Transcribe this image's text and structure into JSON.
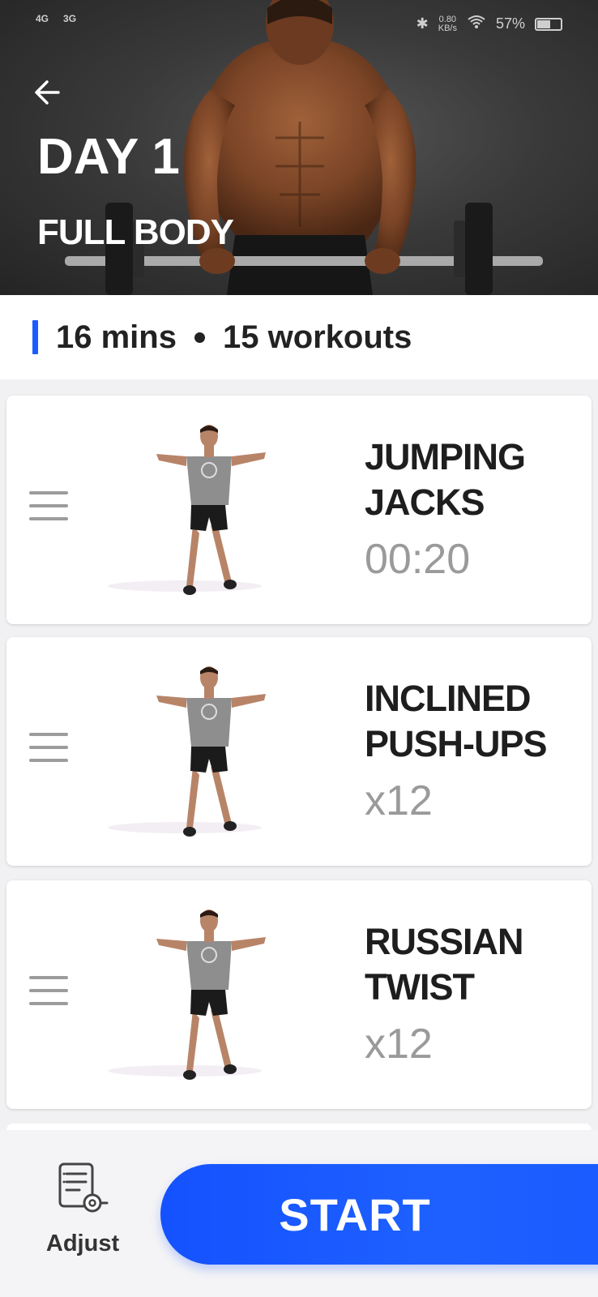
{
  "status_bar": {
    "network_1": "4G",
    "network_2": "3G",
    "speed": "0.80",
    "speed_unit": "KB/s",
    "battery": "57%",
    "battery_level": 0.57
  },
  "header": {
    "title": "DAY 1",
    "subtitle": "FULL BODY"
  },
  "info": {
    "duration": "16 mins",
    "workouts": "15 workouts"
  },
  "exercises": [
    {
      "name": "JUMPING JACKS",
      "amount": "00:20"
    },
    {
      "name": "INCLINED PUSH-UPS",
      "amount": "x12"
    },
    {
      "name": "RUSSIAN TWIST",
      "amount": "x12"
    }
  ],
  "bottom": {
    "adjust_label": "Adjust",
    "start_label": "START"
  },
  "colors": {
    "accent": "#1b5cff",
    "button": "#1a5bff"
  },
  "icons": [
    "back-arrow-icon",
    "drag-handle-icon",
    "adjust-icon"
  ]
}
